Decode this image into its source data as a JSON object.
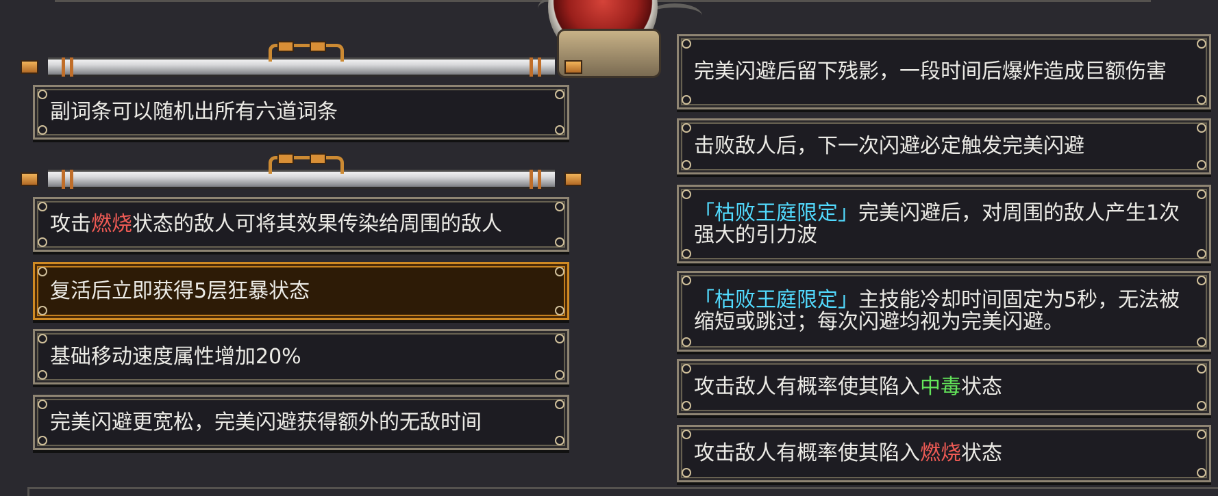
{
  "left_panel": {
    "group1": {
      "cards": [
        {
          "segments": [
            {
              "text": "副词条可以随机出所有六道词条",
              "style": "normal"
            }
          ],
          "active": false
        }
      ]
    },
    "group2": {
      "cards": [
        {
          "segments": [
            {
              "text": "攻击",
              "style": "normal"
            },
            {
              "text": "燃烧",
              "style": "burn"
            },
            {
              "text": "状态的敌人可将其效果传染给周围的敌人",
              "style": "normal"
            }
          ],
          "active": false
        },
        {
          "segments": [
            {
              "text": "复活后立即获得5层狂暴状态",
              "style": "normal"
            }
          ],
          "active": true
        },
        {
          "segments": [
            {
              "text": "基础移动速度属性增加20%",
              "style": "normal"
            }
          ],
          "active": false
        },
        {
          "segments": [
            {
              "text": "完美闪避更宽松，完美闪避获得额外的无敌时间",
              "style": "normal"
            }
          ],
          "active": false
        }
      ]
    }
  },
  "right_panel": {
    "cards": [
      {
        "segments": [
          {
            "text": "完美闪避后留下残影，一段时间后爆炸造成巨额伤害",
            "style": "normal"
          }
        ]
      },
      {
        "segments": [
          {
            "text": "击败敌人后，下一次闪避必定触发完美闪避",
            "style": "normal"
          }
        ]
      },
      {
        "segments": [
          {
            "text": "「枯败王庭限定」",
            "style": "tag"
          },
          {
            "text": "完美闪避后，对周围的敌人产生1次强大的引力波",
            "style": "normal"
          }
        ]
      },
      {
        "segments": [
          {
            "text": "「枯败王庭限定」",
            "style": "tag"
          },
          {
            "text": "主技能冷却时间固定为5秒，无法被缩短或跳过；每次闪避均视为完美闪避。",
            "style": "normal"
          }
        ]
      },
      {
        "segments": [
          {
            "text": "攻击敌人有概率使其陷入",
            "style": "normal"
          },
          {
            "text": "中毒",
            "style": "poison"
          },
          {
            "text": "状态",
            "style": "normal"
          }
        ]
      },
      {
        "segments": [
          {
            "text": "攻击敌人有概率使其陷入",
            "style": "normal"
          },
          {
            "text": "燃烧",
            "style": "burn"
          },
          {
            "text": "状态",
            "style": "normal"
          }
        ]
      }
    ]
  },
  "colors": {
    "background": "#2a292f",
    "burn": "#f05b55",
    "poison": "#63e55a",
    "tag": "#52dbff",
    "active_border": "#d08a23"
  },
  "icons": {
    "top_orb": "red-orb-ornament-icon",
    "scroll_header": "scroll-rod-icon"
  }
}
